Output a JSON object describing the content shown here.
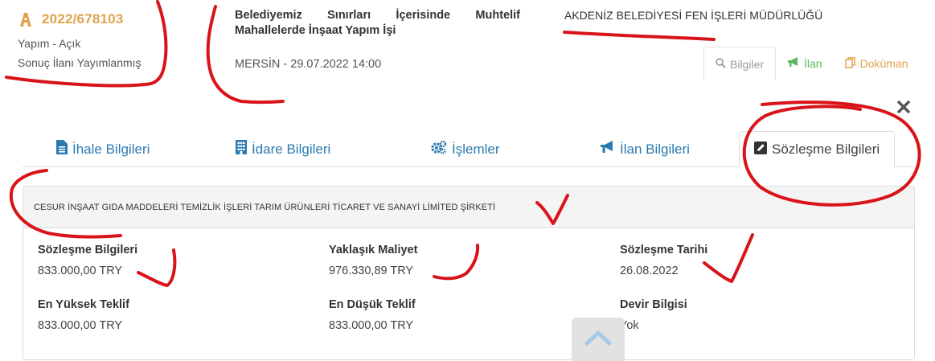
{
  "header": {
    "ikn": "2022/678103",
    "status_line1": "Yapım - Açık",
    "status_line2": "Sonuç İlanı Yayımlanmış",
    "title": "Belediyemiz Sınırları İçerisinde Muhtelif Mahallelerde İnşaat Yapım İşi",
    "place_date": "MERSİN - 29.07.2022 14:00",
    "organization": "AKDENİZ BELEDİYESİ FEN İŞLERİ MÜDÜRLÜĞÜ"
  },
  "actions": {
    "bilgiler": "Bilgiler",
    "ilan": "İlan",
    "dokuman": "Doküman"
  },
  "tabs": {
    "ihale": "İhale Bilgileri",
    "idare": "İdare Bilgileri",
    "islemler": "İşlemler",
    "ilan": "İlan Bilgileri",
    "sozlesme": "Sözleşme Bilgileri"
  },
  "panel": {
    "company": "CESUR İNŞAAT GIDA MADDELERİ TEMİZLİK İŞLERİ TARIM ÜRÜNLERİ TİCARET VE SANAYİ LİMİTED ŞİRKETİ",
    "fields": {
      "sozlesme_bedeli": {
        "label": "Sözleşme Bilgileri",
        "value": "833.000,00 TRY"
      },
      "yaklasik_maliyet": {
        "label": "Yaklaşık Maliyet",
        "value": "976.330,89 TRY"
      },
      "sozlesme_tarihi": {
        "label": "Sözleşme Tarihi",
        "value": "26.08.2022"
      },
      "en_yuksek": {
        "label": "En Yüksek Teklif",
        "value": "833.000,00 TRY"
      },
      "en_dusuk": {
        "label": "En Düşük Teklif",
        "value": "833.000,00 TRY"
      },
      "devir": {
        "label": "Devir Bilgisi",
        "value": "Yok"
      }
    }
  },
  "colors": {
    "accent_orange": "#e0a24a",
    "link_blue": "#2a7ab0",
    "success_green": "#5cb85c",
    "annotation_red": "#d8141a"
  },
  "icons": {
    "ikn": "construction-icon",
    "bilgiler": "search-icon",
    "ilan": "bullhorn-icon",
    "dokuman": "copy-icon",
    "close": "close-icon",
    "ihale": "file-text-icon",
    "idare": "building-icon",
    "islemler": "gears-icon",
    "ilan_tab": "bullhorn-icon",
    "sozlesme": "edit-square-icon",
    "scroll_up": "chevron-up-icon"
  }
}
